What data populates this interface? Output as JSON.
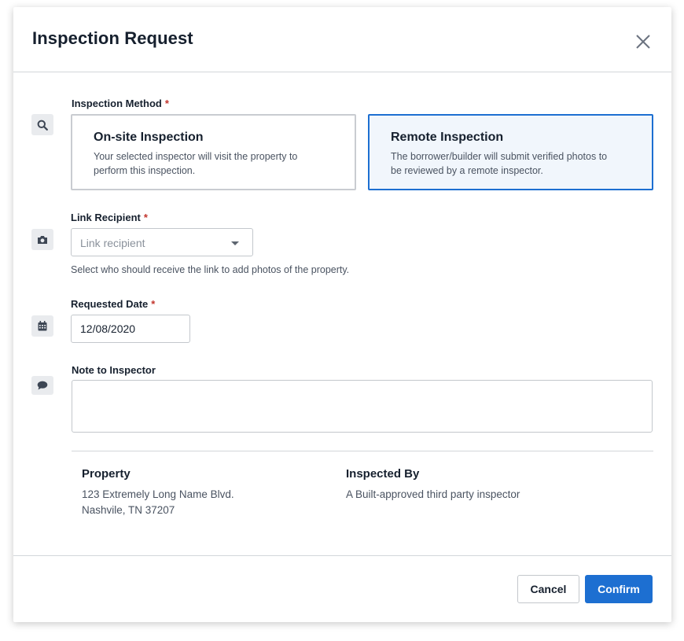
{
  "dialog": {
    "title": "Inspection Request",
    "close_icon": "close-icon"
  },
  "inspection_method": {
    "label": "Inspection Method",
    "required_mark": "*",
    "icon": "search-icon",
    "options": [
      {
        "title": "On-site Inspection",
        "description": "Your selected inspector will visit the property to perform this inspection.",
        "selected": false
      },
      {
        "title": "Remote Inspection",
        "description": "The borrower/builder will submit verified photos to be reviewed by a remote inspector.",
        "selected": true
      }
    ]
  },
  "link_recipient": {
    "label": "Link Recipient",
    "required_mark": "*",
    "icon": "camera-icon",
    "placeholder": "Link recipient",
    "help_text": "Select who should receive the link to add photos of the property."
  },
  "requested_date": {
    "label": "Requested Date",
    "required_mark": "*",
    "icon": "calendar-icon",
    "value": "12/08/2020"
  },
  "note": {
    "label": "Note to Inspector",
    "icon": "comment-icon",
    "value": ""
  },
  "property": {
    "heading": "Property",
    "line1": "123 Extremely Long Name Blvd.",
    "line2": "Nashvile, TN 37207"
  },
  "inspected_by": {
    "heading": "Inspected By",
    "text": "A Built-approved third party inspector"
  },
  "footer": {
    "cancel_label": "Cancel",
    "confirm_label": "Confirm"
  },
  "colors": {
    "primary": "#1d6fd1",
    "required": "#c2352d",
    "selected_card_bg": "#f1f6fc"
  }
}
